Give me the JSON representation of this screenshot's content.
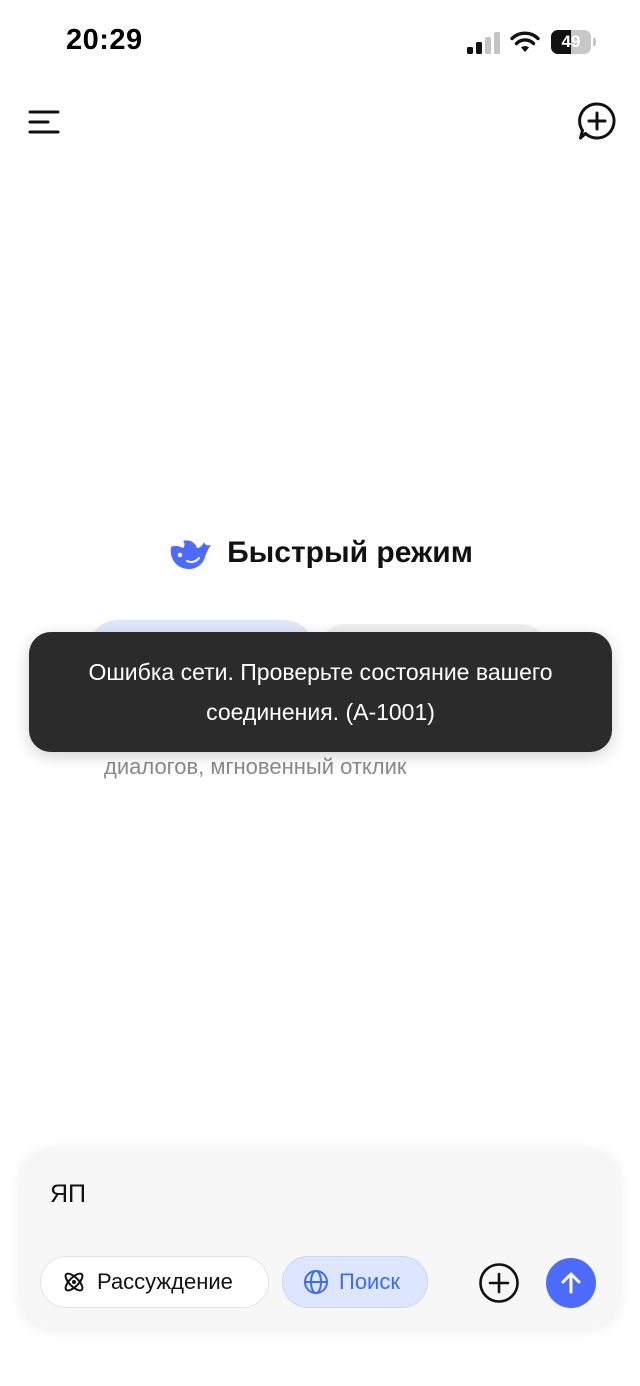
{
  "status_bar": {
    "time": "20:29",
    "battery_level": "49",
    "battery_fraction": 0.49,
    "icons": [
      "signal-icon",
      "wifi-icon",
      "battery-icon"
    ]
  },
  "header": {
    "menu_icon": "menu-icon",
    "new_chat_icon": "new-chat-icon"
  },
  "main": {
    "logo_icon": "whale-logo-icon",
    "mode_title": "Быстрый режим",
    "mode_description": "диалогов, мгновенный отклик"
  },
  "toast": {
    "message": "Ошибка сети. Проверьте состояние вашего соединения. (A-1001)"
  },
  "composer": {
    "input_value": "ЯП",
    "think_label": "Рассуждение",
    "search_label": "Поиск",
    "think_icon": "atom-icon",
    "search_icon": "globe-icon",
    "attach_icon": "plus-circle-icon",
    "send_icon": "arrow-up-icon"
  },
  "colors": {
    "accent": "#4d6bfe",
    "search_pill_bg": "#dde6fc",
    "toast_bg": "#2b2b2b"
  }
}
